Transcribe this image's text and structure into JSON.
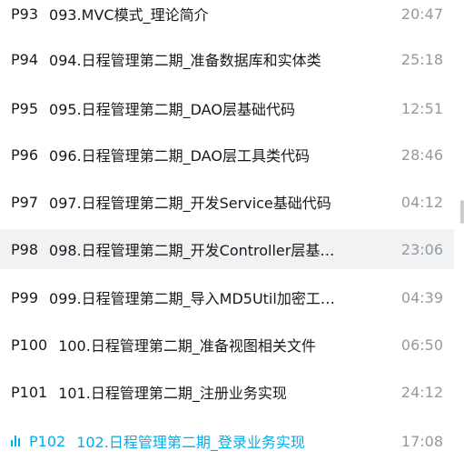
{
  "episodes": [
    {
      "ep": "P93",
      "title": "093.MVC模式_理论简介",
      "duration": "20:47"
    },
    {
      "ep": "P94",
      "title": "094.日程管理第二期_准备数据库和实体类",
      "duration": "25:18"
    },
    {
      "ep": "P95",
      "title": "095.日程管理第二期_DAO层基础代码",
      "duration": "12:51"
    },
    {
      "ep": "P96",
      "title": "096.日程管理第二期_DAO层工具类代码",
      "duration": "28:46"
    },
    {
      "ep": "P97",
      "title": "097.日程管理第二期_开发Service基础代码",
      "duration": "04:12"
    },
    {
      "ep": "P98",
      "title": "098.日程管理第二期_开发Controller层基…",
      "duration": "23:06"
    },
    {
      "ep": "P99",
      "title": "099.日程管理第二期_导入MD5Util加密工…",
      "duration": "04:39"
    },
    {
      "ep": "P100",
      "title": "100.日程管理第二期_准备视图相关文件",
      "duration": "06:50"
    },
    {
      "ep": "P101",
      "title": "101.日程管理第二期_注册业务实现",
      "duration": "24:12"
    },
    {
      "ep": "P102",
      "title": "102.日程管理第二期_登录业务实现",
      "duration": "17:08"
    }
  ],
  "colors": {
    "active": "#00aeec",
    "text": "#18191c",
    "duration": "#9499a0",
    "hover_bg": "#f1f2f3"
  },
  "icons": {
    "now_playing": "playing-bars-icon"
  }
}
